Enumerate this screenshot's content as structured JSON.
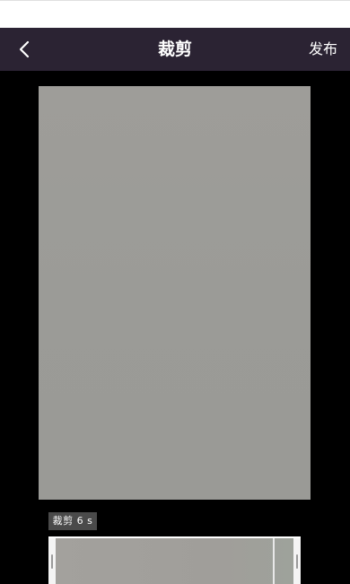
{
  "header": {
    "back_icon": "chevron-left-icon",
    "title": "裁剪",
    "publish_label": "发布",
    "background": "#2b2333"
  },
  "editor": {
    "duration_label": "裁剪 6 s",
    "preview_color": "#9c9c98"
  }
}
